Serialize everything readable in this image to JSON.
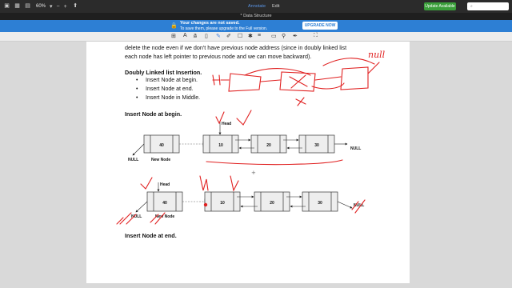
{
  "toolbar": {
    "zoom": "60%",
    "zoom_out": "−",
    "zoom_in": "+",
    "tab_annotate": "Annotate",
    "tab_edit": "Edit",
    "update_label": "Update Available",
    "search_placeholder": ""
  },
  "window": {
    "title": "* Data Structure"
  },
  "banner": {
    "title": "Your changes are not saved.",
    "subtitle": "To save them, please upgrade to the Full version.",
    "button": "UPGRADE NOW"
  },
  "document": {
    "para_line1": "delete the node even if we don't have previous node address (since in doubly linked list",
    "para_line2": "each node has left pointer to previous node and we can move backward).",
    "heading_insertion": "Doubly Linked list Insertion.",
    "bullets": [
      "Insert Node at begin.",
      "Insert Node at end.",
      "Insert Node in Middle."
    ],
    "heading_begin": "Insert Node at begin.",
    "heading_end": "Insert Node at end."
  },
  "diagram1": {
    "head_label": "Head",
    "new_node_value": "40",
    "new_node_label": "New Node",
    "null_left": "NULL",
    "null_right": "NULL",
    "nodes": [
      "10",
      "20",
      "30"
    ]
  },
  "diagram2": {
    "head_label": "Head",
    "new_node_value": "40",
    "new_node_label": "New Node",
    "null_left": "NULL",
    "null_right": "NULL",
    "nodes": [
      "10",
      "20",
      "30"
    ]
  },
  "handwriting": {
    "null_text": "null",
    "head_letter": "H"
  },
  "colors": {
    "ink": "#e02020",
    "banner": "#2d7fd4",
    "update": "#3a9e3a"
  }
}
